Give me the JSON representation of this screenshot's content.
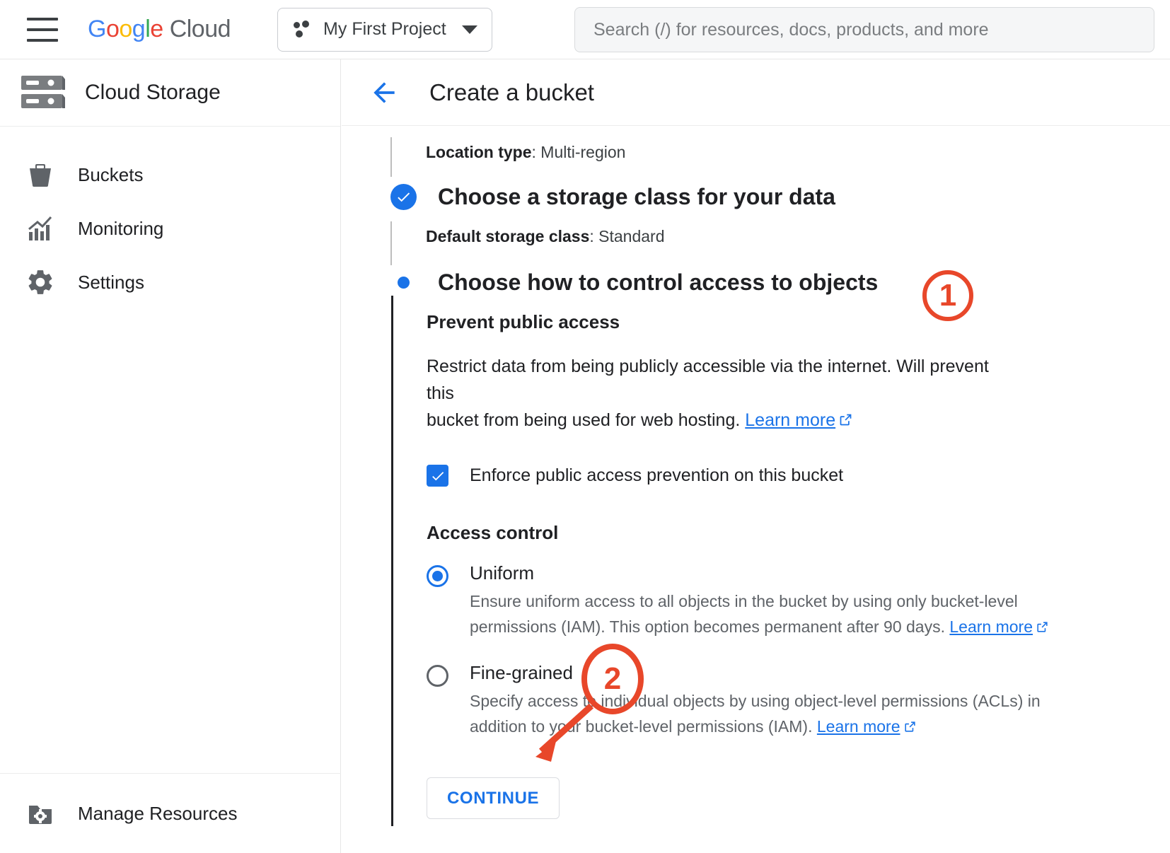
{
  "topbar": {
    "menu_icon": "hamburger-menu-icon",
    "logo": {
      "google": "Google",
      "cloud": "Cloud"
    },
    "project_selector": {
      "name": "My First Project",
      "icon": "project-dots-icon",
      "caret": "chevron-down-icon"
    },
    "search": {
      "placeholder": "Search (/) for resources, docs, products, and more",
      "value": ""
    }
  },
  "sidebar": {
    "product": {
      "title": "Cloud Storage",
      "icon": "storage-server-icon"
    },
    "items": [
      {
        "label": "Buckets",
        "icon": "bucket-icon"
      },
      {
        "label": "Monitoring",
        "icon": "chart-icon"
      },
      {
        "label": "Settings",
        "icon": "gear-icon"
      }
    ],
    "bottom": {
      "label": "Manage Resources",
      "icon": "folder-gear-icon"
    }
  },
  "main": {
    "back_icon": "back-arrow-icon",
    "title": "Create a bucket",
    "steps": [
      {
        "id": "location",
        "summary_label": "Location type",
        "summary_value": "Multi-region"
      },
      {
        "id": "storage-class",
        "marker": "check-circle-icon",
        "title": "Choose a storage class for your data",
        "summary_label": "Default storage class",
        "summary_value": "Standard"
      },
      {
        "id": "access-control",
        "marker": "active-dot-icon",
        "title": "Choose how to control access to objects"
      }
    ],
    "access": {
      "prevent_heading": "Prevent public access",
      "prevent_desc_1": "Restrict data from being publicly accessible via the internet. Will prevent this",
      "prevent_desc_2": "bucket from being used for web hosting. ",
      "learn_more": "Learn more",
      "checkbox": {
        "label": "Enforce public access prevention on this bucket",
        "checked": true,
        "icon": "checkmark-icon"
      },
      "control_heading": "Access control",
      "options": [
        {
          "id": "uniform",
          "title": "Uniform",
          "selected": true,
          "desc_1": "Ensure uniform access to all objects in the bucket by using only bucket-level",
          "desc_2": "permissions (IAM). This option becomes permanent after 90 days. ",
          "learn_more": "Learn more"
        },
        {
          "id": "fine-grained",
          "title": "Fine-grained",
          "selected": false,
          "desc_1": "Specify access to individual objects by using object-level permissions (ACLs) in",
          "desc_2": "addition to your bucket-level permissions (IAM). ",
          "learn_more": "Learn more"
        }
      ],
      "continue_label": "CONTINUE"
    }
  },
  "annotations": {
    "color": "#E8472A",
    "markers": [
      {
        "id": "marker-1",
        "label": "1"
      },
      {
        "id": "marker-2",
        "label": "2"
      }
    ]
  }
}
